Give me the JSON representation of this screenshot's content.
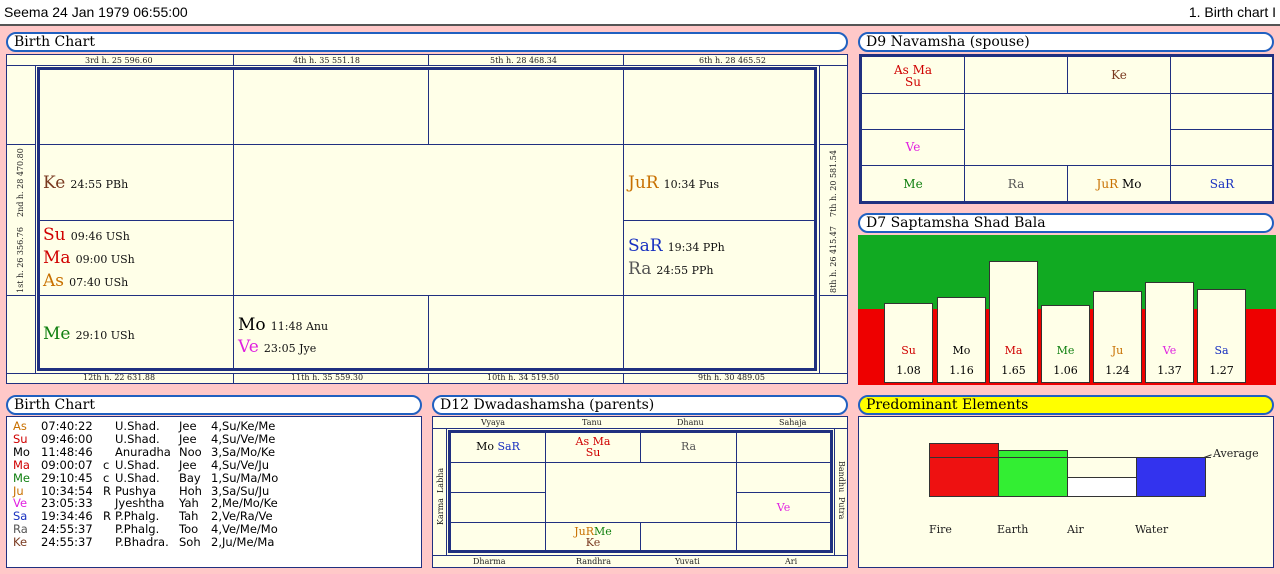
{
  "title_bar": {
    "left": "Seema  24 Jan 1979 06:55:00",
    "right": "1. Birth chart I"
  },
  "birth_chart": {
    "header": "Birth Chart",
    "top_labels": [
      "3rd h.  25  596.60",
      "4th h.  35  551.18",
      "5th h.  28  468.34",
      "6th h.  28  465.52"
    ],
    "bottom_labels": [
      "12th h.  22  631.88",
      "11th h.  35  559.30",
      "10th h.  34  519.50",
      "9th h.  30  489.05"
    ],
    "left_labels": [
      "2nd h.  28  470.80",
      "1st h.  26  356.76"
    ],
    "right_labels": [
      "7th h.  20  581.54",
      "8th h.  26  415.47"
    ],
    "cells": {
      "house2": [
        {
          "p": "Ke",
          "d": "24:55 PBh"
        }
      ],
      "house1": [
        {
          "p": "Su",
          "d": "09:46 USh"
        },
        {
          "p": "Ma",
          "d": "09:00 USh"
        },
        {
          "p": "As",
          "d": "07:40 USh"
        }
      ],
      "house12": [
        {
          "p": "Me",
          "d": "29:10 USh"
        }
      ],
      "house11": [
        {
          "p": "Mo",
          "d": "11:48 Anu"
        },
        {
          "p": "Ve",
          "d": "23:05 Jye"
        }
      ],
      "house7": [
        {
          "p": "JuR",
          "d": "10:34 Pus"
        }
      ],
      "house8": [
        {
          "p": "SaR",
          "d": "19:34 PPh"
        },
        {
          "p": "Ra",
          "d": "24:55 PPh"
        }
      ]
    }
  },
  "navamsha": {
    "header": "D9 Navamsha  (spouse)",
    "cells": {
      "r0c0_a": "As Ma",
      "r0c0_b": "Su",
      "r0c2": "Ke",
      "r2c0": "Ve",
      "r3c0": "Me",
      "r3c1": "Ra",
      "r3c2_a": "JuR",
      "r3c2_b": "Mo",
      "r3c3": "SaR"
    }
  },
  "saptamsha": {
    "header": "D7 Saptamsha  Shad Bala",
    "bars": [
      {
        "planet": "Su",
        "value": "1.08",
        "color": "#d00000"
      },
      {
        "planet": "Mo",
        "value": "1.16",
        "color": "#000000"
      },
      {
        "planet": "Ma",
        "value": "1.65",
        "color": "#d00000"
      },
      {
        "planet": "Me",
        "value": "1.06",
        "color": "#108010"
      },
      {
        "planet": "Ju",
        "value": "1.24",
        "color": "#c87000"
      },
      {
        "planet": "Ve",
        "value": "1.37",
        "color": "#e020e0"
      },
      {
        "planet": "Sa",
        "value": "1.27",
        "color": "#1830c0"
      }
    ]
  },
  "birth_table": {
    "header": "Birth Chart",
    "rows": [
      {
        "p": "As",
        "time": "07:40:22",
        "flag": "",
        "nak": "U.Shad.",
        "syl": "Jee",
        "lords": "4,Su/Ke/Me",
        "color": "#c87000"
      },
      {
        "p": "Su",
        "time": "09:46:00",
        "flag": "",
        "nak": "U.Shad.",
        "syl": "Jee",
        "lords": "4,Su/Ve/Me",
        "color": "#d00000"
      },
      {
        "p": "Mo",
        "time": "11:48:46",
        "flag": "",
        "nak": "Anuradha",
        "syl": "Noo",
        "lords": "3,Sa/Mo/Ke",
        "color": "#000000"
      },
      {
        "p": "Ma",
        "time": "09:00:07",
        "flag": "c",
        "nak": "U.Shad.",
        "syl": "Jee",
        "lords": "4,Su/Ve/Ju",
        "color": "#d00000"
      },
      {
        "p": "Me",
        "time": "29:10:45",
        "flag": "c",
        "nak": "U.Shad.",
        "syl": "Bay",
        "lords": "1,Su/Ma/Mo",
        "color": "#108010"
      },
      {
        "p": "Ju",
        "time": "10:34:54",
        "flag": "R",
        "nak": "Pushya",
        "syl": "Hoh",
        "lords": "3,Sa/Su/Ju",
        "color": "#c87000"
      },
      {
        "p": "Ve",
        "time": "23:05:33",
        "flag": "",
        "nak": "Jyeshtha",
        "syl": "Yah",
        "lords": "2,Me/Mo/Ke",
        "color": "#e020e0"
      },
      {
        "p": "Sa",
        "time": "19:34:46",
        "flag": "R",
        "nak": "P.Phalg.",
        "syl": "Tah",
        "lords": "2,Ve/Ra/Ve",
        "color": "#1830c0"
      },
      {
        "p": "Ra",
        "time": "24:55:37",
        "flag": "",
        "nak": "P.Phalg.",
        "syl": "Too",
        "lords": "4,Ve/Me/Mo",
        "color": "#555555"
      },
      {
        "p": "Ke",
        "time": "24:55:37",
        "flag": "",
        "nak": "P.Bhadra.",
        "syl": "Soh",
        "lords": "2,Ju/Me/Ma",
        "color": "#7a3a20"
      }
    ]
  },
  "dwadashamsha": {
    "header": "D12 Dwadashamsha  (parents)",
    "top_labels": [
      "Vyaya",
      "Tanu",
      "Dhanu",
      "Sahaja"
    ],
    "bottom_labels": [
      "Dharma",
      "Randhra",
      "Yuvati",
      "Ari"
    ],
    "left_labels": [
      "Labha",
      "Karma"
    ],
    "right_labels": [
      "Bandhu",
      "Putra"
    ],
    "cells": {
      "c0_a": "Mo",
      "c0_b": "SaR",
      "c1_a": "As Ma",
      "c1_b": "Su",
      "c2": "Ra",
      "r2c3": "Ve",
      "b1_a": "JuR",
      "b1_b": "Me",
      "b1_c": "Ke"
    }
  },
  "elements": {
    "header": "Predominant Elements",
    "average_label": "Average",
    "labels": [
      "Fire",
      "Earth",
      "Air",
      "Water"
    ],
    "colors": [
      "#ee1111",
      "#33ee33",
      "#ffffff",
      "#3333ee"
    ]
  }
}
